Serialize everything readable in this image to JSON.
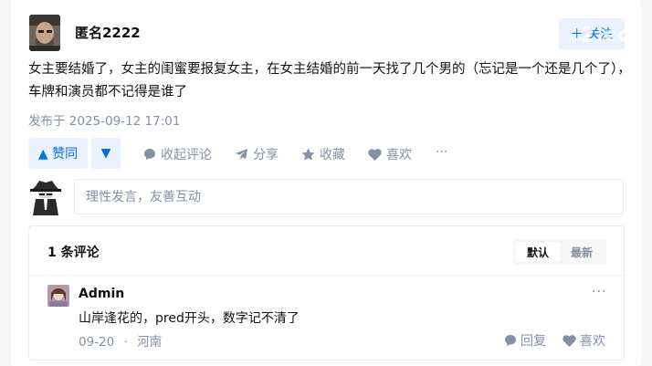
{
  "author": {
    "name": "匿名2222"
  },
  "follow_label": "＋ 关注",
  "watermark": "2.co",
  "post": {
    "content": "女主要结婚了，女主的闺蜜要报复女主，在女主结婚的前一天找了几个男的（忘记是一个还是几个了），车牌和演员都不记得是谁了",
    "published": "发布于 2025-09-12 17:01"
  },
  "actions": {
    "upvote": "▲ 赞同",
    "downvote": "▼",
    "collapse_comments": "收起评论",
    "share": "分享",
    "favorite": "收藏",
    "like": "喜欢",
    "more": "···"
  },
  "comment_input": {
    "placeholder": "理性发言，友善互动"
  },
  "comments": {
    "count_label": "1 条评论",
    "sort_default": "默认",
    "sort_newest": "最新",
    "items": [
      {
        "author": "Admin",
        "text": "山岸逢花的，pred开头，数字记不清了",
        "date": "09-20",
        "separator": "·",
        "location": "河南",
        "reply_label": "回复",
        "like_label": "喜欢",
        "more": "···"
      }
    ]
  },
  "colors": {
    "accent": "#056de8",
    "accent_bg": "#eaf2ff",
    "muted": "#8590a6",
    "text": "#121212"
  }
}
